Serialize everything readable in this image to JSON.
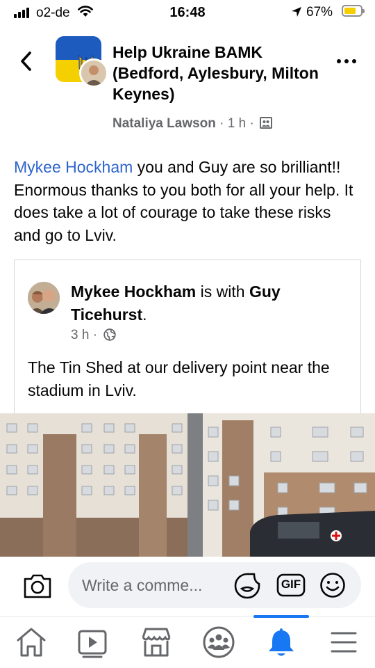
{
  "status_bar": {
    "carrier": "o2-de",
    "time": "16:48",
    "battery": "67%",
    "battery_level": 0.67,
    "icons": [
      "signal-icon",
      "wifi-icon",
      "location-icon",
      "battery-icon"
    ]
  },
  "header": {
    "group_name": "Help Ukraine BAMK (Bedford, Aylesbury, Milton Keynes)",
    "author": "Nataliya Lawson",
    "time_ago": "1 h",
    "separator": "·",
    "icons": [
      "back-chevron-icon",
      "privacy-group-icon",
      "more-dots-icon"
    ]
  },
  "post": {
    "mention": "Mykee Hockham",
    "text": " you and Guy are so brilliant!! Enormous thanks to you both for all your help. It does take a lot of courage to take these risks and go to Lviv."
  },
  "shared_post": {
    "author": "Mykee Hockham",
    "with_text": " is with ",
    "tagged": "Guy Ticehurst",
    "period": ".",
    "time_ago": "3 h",
    "separator": "·",
    "text": "The Tin Shed at our delivery point near the stadium in Lviv.",
    "icons": [
      "globe-icon"
    ]
  },
  "composer": {
    "placeholder": "Write a comme...",
    "gif_label": "GIF",
    "icons": [
      "camera-icon",
      "sticker-icon",
      "gif-icon",
      "emoji-icon"
    ]
  },
  "bottom_nav": {
    "active": "notifications",
    "items": [
      "home-icon",
      "video-icon",
      "marketplace-icon",
      "groups-icon",
      "notifications-icon",
      "menu-icon"
    ]
  },
  "colors": {
    "link": "#2d64cc",
    "secondary_text": "#65676b",
    "brand_blue": "#1877f2",
    "input_bg": "#f0f2f5",
    "battery_fill": "#f7ce00"
  }
}
